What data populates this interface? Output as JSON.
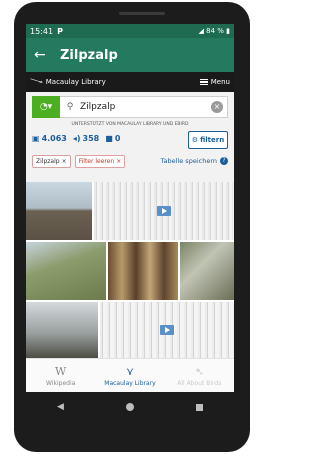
{
  "status_bar": {
    "time": "15:41",
    "right": "84 %"
  },
  "app_bar": {
    "title": "Zilpzalp"
  },
  "ml_bar": {
    "brand": "Macaulay Library",
    "menu_label": "Menu"
  },
  "search": {
    "value": "Zilpzalp",
    "powered_by": "UNTERSTÜTZT VON MACAULAY LIBRARY UND EBIRD"
  },
  "counts": {
    "photos": "4.063",
    "audio": "358",
    "video": "0"
  },
  "filter_button": "filtern",
  "chips": {
    "species": "Zilpzalp",
    "clear": "Filter leeren"
  },
  "save_table": "Tabelle speichern",
  "bottom_nav": [
    {
      "label": "Wikipedia",
      "icon": "wikipedia-icon"
    },
    {
      "label": "Macaulay Library",
      "icon": "macaulay-bird-icon"
    },
    {
      "label": "All About Birds",
      "icon": "all-about-birds-icon"
    }
  ],
  "colors": {
    "status": "#1f6b52",
    "appbar": "#237a5e",
    "accent_blue": "#1b5e9a",
    "green_button": "#4caf22"
  }
}
